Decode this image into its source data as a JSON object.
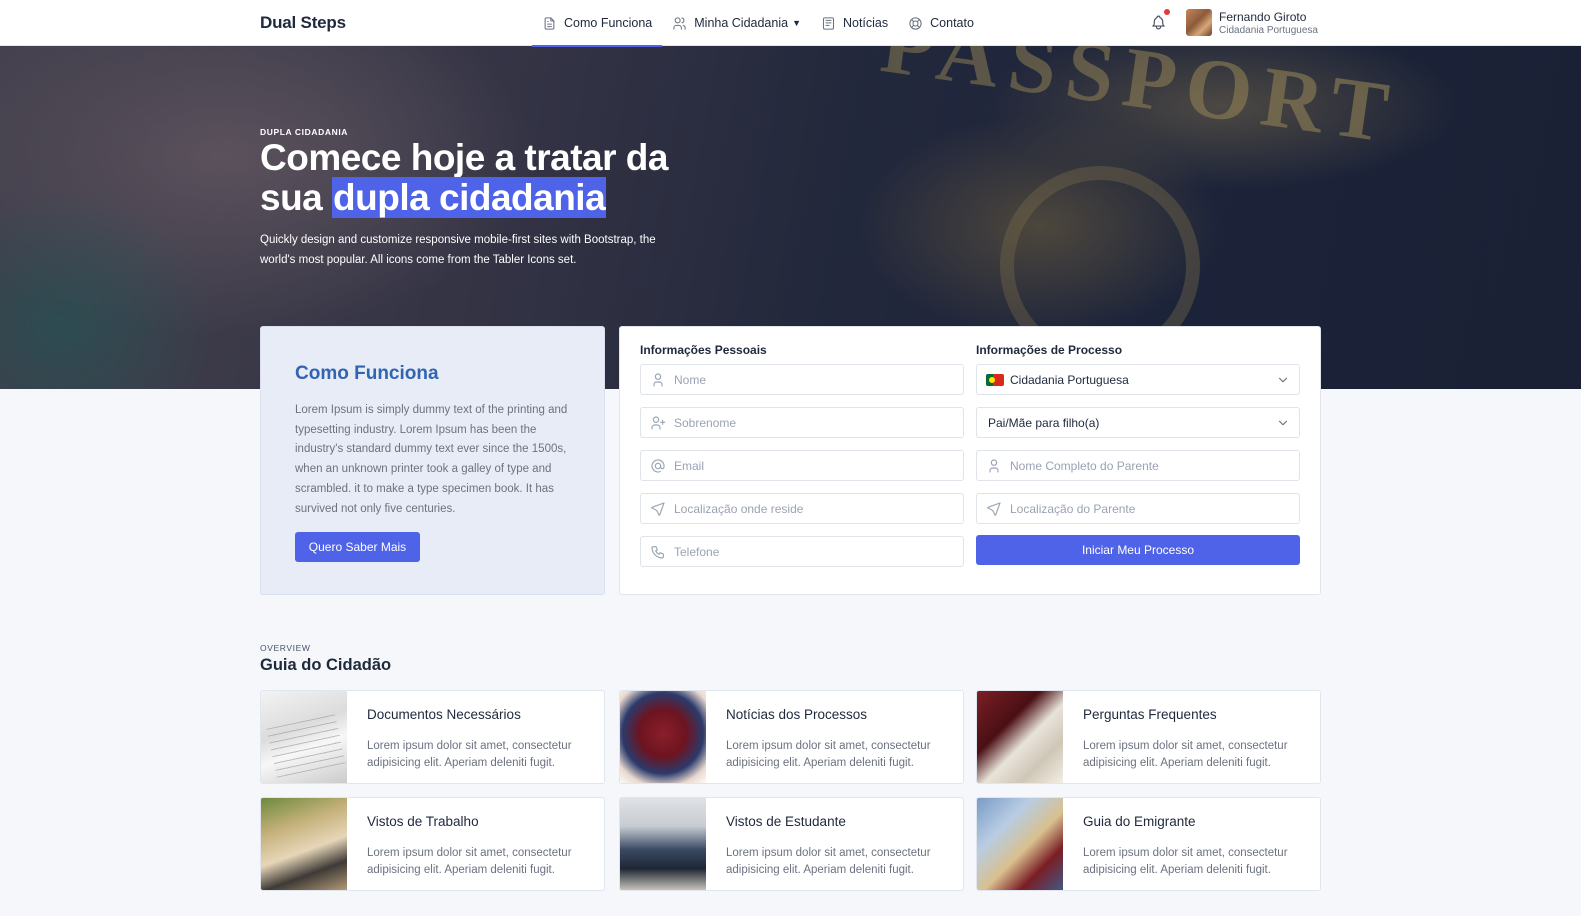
{
  "nav": {
    "brand": "Dual Steps",
    "items": [
      {
        "label": "Como Funciona",
        "icon": "file-text-icon",
        "active": true
      },
      {
        "label": "Minha Cidadania",
        "icon": "users-icon",
        "dropdown": true
      },
      {
        "label": "Notícias",
        "icon": "news-icon"
      },
      {
        "label": "Contato",
        "icon": "lifebuoy-icon"
      }
    ],
    "user": {
      "name": "Fernando Giroto",
      "role": "Cidadania Portuguesa"
    },
    "notification_dot_color": "#e53935"
  },
  "hero": {
    "pretitle": "DUPLA CIDADANIA",
    "title_before": "Comece hoje a tratar da sua ",
    "title_highlight": "dupla cidadania",
    "subtitle": "Quickly design and customize responsive mobile-first sites with Bootstrap, the world's most popular. All icons come from the Tabler Icons set."
  },
  "how": {
    "title": "Como Funciona",
    "text": "Lorem Ipsum is simply dummy text of the printing and typesetting industry. Lorem Ipsum has been the industry's standard dummy text ever since the 1500s, when an unknown printer took a galley of type and scrambled. it to make a type specimen book. It has survived not only five centuries.",
    "button": "Quero Saber Mais"
  },
  "form": {
    "personal_heading": "Informações Pessoais",
    "process_heading": "Informações de Processo",
    "personal_fields": [
      {
        "placeholder": "Nome",
        "icon": "user-icon"
      },
      {
        "placeholder": "Sobrenome",
        "icon": "user-plus-icon"
      },
      {
        "placeholder": "Email",
        "icon": "at-icon"
      },
      {
        "placeholder": "Localização onde reside",
        "icon": "send-icon"
      },
      {
        "placeholder": "Telefone",
        "icon": "phone-icon"
      }
    ],
    "citizenship_select": "Cidadania Portuguesa",
    "relation_select": "Pai/Mãe para filho(a)",
    "parent_name_placeholder": "Nome Completo do Parente",
    "parent_location_placeholder": "Localização do Parente",
    "submit": "Iniciar Meu Processo"
  },
  "overview": {
    "pretitle": "OVERVIEW",
    "title": "Guia do Cidadão",
    "cards": [
      {
        "title": "Documentos Necessários",
        "text": "Lorem ipsum dolor sit amet, consectetur adipisicing elit. Aperiam deleniti fugit."
      },
      {
        "title": "Notícias dos Processos",
        "text": "Lorem ipsum dolor sit amet, consectetur adipisicing elit. Aperiam deleniti fugit."
      },
      {
        "title": "Perguntas Frequentes",
        "text": "Lorem ipsum dolor sit amet, consectetur adipisicing elit. Aperiam deleniti fugit."
      },
      {
        "title": "Vistos de Trabalho",
        "text": "Lorem ipsum dolor sit amet, consectetur adipisicing elit. Aperiam deleniti fugit."
      },
      {
        "title": "Vistos de Estudante",
        "text": "Lorem ipsum dolor sit amet, consectetur adipisicing elit. Aperiam deleniti fugit."
      },
      {
        "title": "Guia do Emigrante",
        "text": "Lorem ipsum dolor sit amet, consectetur adipisicing elit. Aperiam deleniti fugit."
      }
    ]
  },
  "colors": {
    "accent": "#4f63e8",
    "heading_blue": "#2f65b1",
    "page_bg": "#f5f7fb"
  }
}
